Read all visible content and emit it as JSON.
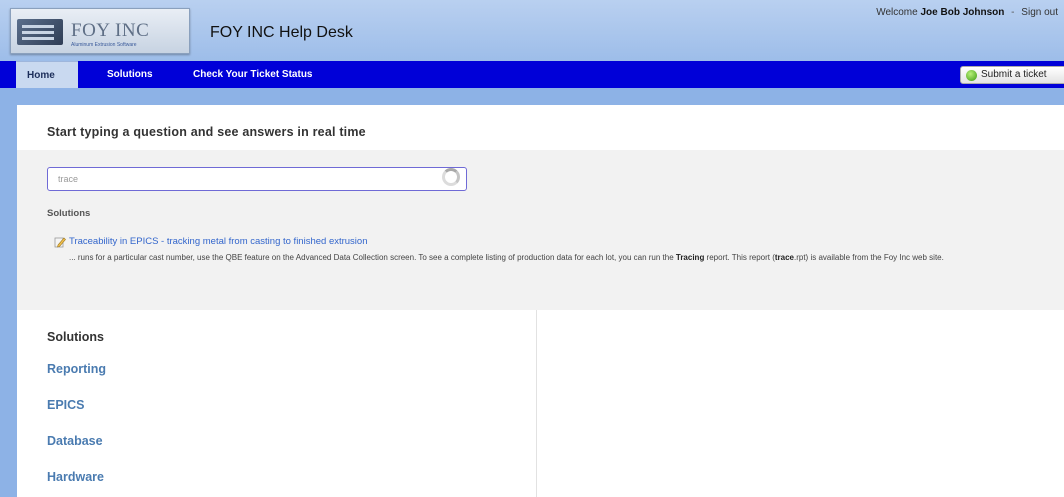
{
  "header": {
    "logo_text": "FOY INC",
    "logo_tagline": "Aluminum Extrusion Software",
    "site_title": "FOY INC Help Desk",
    "welcome_prefix": "Welcome",
    "user_name": "Joe Bob Johnson",
    "separator": "-",
    "sign_out": "Sign out"
  },
  "nav": {
    "tabs": [
      {
        "label": "Home",
        "active": true
      },
      {
        "label": "Solutions",
        "active": false
      },
      {
        "label": "Check Your Ticket Status",
        "active": false
      }
    ],
    "submit_ticket": "Submit a ticket"
  },
  "search": {
    "heading": "Start typing a question and see answers in real time",
    "value": "trace",
    "results_label": "Solutions",
    "results": [
      {
        "title": "Traceability in EPICS - tracking metal from casting to finished extrusion",
        "snippet_part1": "... runs for a particular cast number, use the QBE feature on the Advanced Data Collection screen.  To see a complete listing of production data for each lot, you can run the ",
        "snippet_bold1": "Tracing",
        "snippet_part2": " report.  This report (",
        "snippet_bold2": "trace",
        "snippet_part3": ".rpt) is available from the Foy Inc web site."
      }
    ]
  },
  "solutions": {
    "heading": "Solutions",
    "categories": [
      "Reporting",
      "EPICS",
      "Database",
      "Hardware"
    ]
  },
  "colors": {
    "nav_background": "#0000d8",
    "header_background": "#9dbde9",
    "link": "#4a7bb0",
    "accent_input_border": "#6f6ad6"
  }
}
